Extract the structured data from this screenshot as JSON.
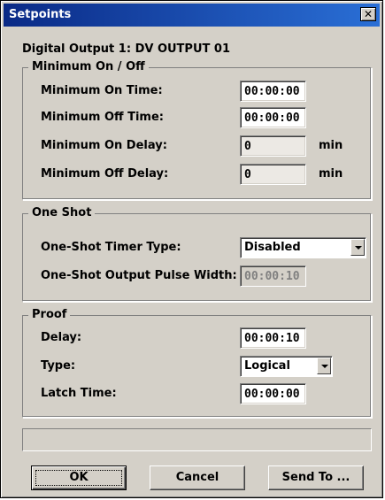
{
  "window": {
    "title": "Setpoints",
    "close_glyph": "✕"
  },
  "header": "Digital Output 1: DV OUTPUT 01",
  "minimum": {
    "legend": "Minimum On / Off",
    "on_time": {
      "label": "Minimum On Time:",
      "value": "00:00:00"
    },
    "off_time": {
      "label": "Minimum Off Time:",
      "value": "00:00:00"
    },
    "on_delay": {
      "label": "Minimum On Delay:",
      "value": "0",
      "unit": "min"
    },
    "off_delay": {
      "label": "Minimum Off Delay:",
      "value": "0",
      "unit": "min"
    }
  },
  "oneshot": {
    "legend": "One Shot",
    "timer_type": {
      "label": "One-Shot Timer Type:",
      "value": "Disabled"
    },
    "pulse_width": {
      "label": "One-Shot Output Pulse Width:",
      "value": "00:00:10"
    }
  },
  "proof": {
    "legend": "Proof",
    "delay": {
      "label": "Delay:",
      "value": "00:00:10"
    },
    "type": {
      "label": "Type:",
      "value": "Logical"
    },
    "latch": {
      "label": "Latch Time:",
      "value": "00:00:00"
    }
  },
  "status_text": "",
  "buttons": {
    "ok": "OK",
    "cancel": "Cancel",
    "send_to": "Send To ..."
  }
}
